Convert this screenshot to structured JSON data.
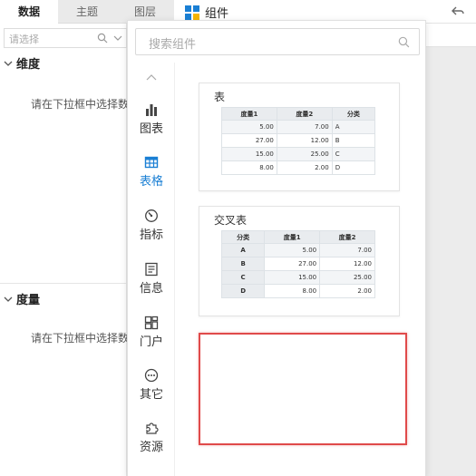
{
  "tabs": [
    {
      "label": "数据",
      "active": true
    },
    {
      "label": "主题",
      "active": false
    },
    {
      "label": "图层",
      "active": false
    }
  ],
  "topbar": {
    "component_label": "组件"
  },
  "left": {
    "select_placeholder": "请选择",
    "dimension": {
      "title": "维度",
      "hint": "请在下拉框中选择数据"
    },
    "measure": {
      "title": "度量",
      "hint": "请在下拉框中选择数据"
    }
  },
  "popup": {
    "search_placeholder": "搜索组件",
    "categories": [
      {
        "label": "图表",
        "icon": "bar-chart-icon",
        "active": false
      },
      {
        "label": "表格",
        "icon": "table-icon",
        "active": true
      },
      {
        "label": "指标",
        "icon": "gauge-icon",
        "active": false
      },
      {
        "label": "信息",
        "icon": "info-doc-icon",
        "active": false
      },
      {
        "label": "门户",
        "icon": "portal-icon",
        "active": false
      },
      {
        "label": "其它",
        "icon": "more-icon",
        "active": false
      },
      {
        "label": "资源",
        "icon": "puzzle-icon",
        "active": false
      }
    ],
    "table_card": {
      "title": "表",
      "headers": [
        "度量1",
        "度量2",
        "分类"
      ],
      "rows": [
        [
          "5.00",
          "7.00",
          "A"
        ],
        [
          "27.00",
          "12.00",
          "B"
        ],
        [
          "15.00",
          "25.00",
          "C"
        ],
        [
          "8.00",
          "2.00",
          "D"
        ]
      ]
    },
    "crosstab_card": {
      "title": "交叉表",
      "headers": [
        "分类",
        "度量1",
        "度量2"
      ],
      "rows": [
        [
          "A",
          "5.00",
          "7.00"
        ],
        [
          "B",
          "27.00",
          "12.00"
        ],
        [
          "C",
          "15.00",
          "25.00"
        ],
        [
          "D",
          "8.00",
          "2.00"
        ]
      ]
    }
  },
  "colors": {
    "accent": "#1a7fd4",
    "highlight": "#e04a4a",
    "logo_blue": "#1a7fd4",
    "logo_yellow": "#f5b400"
  }
}
